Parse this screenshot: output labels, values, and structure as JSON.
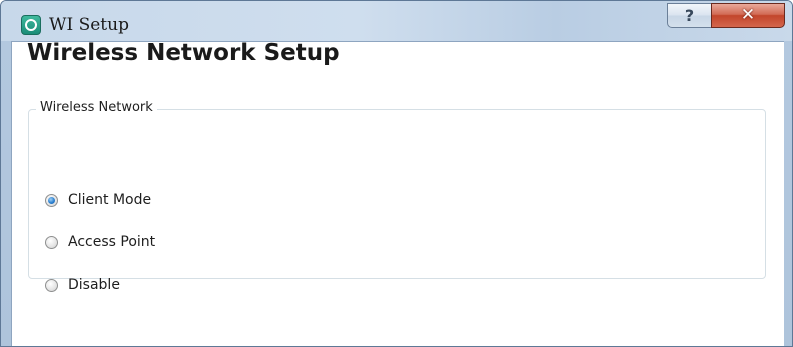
{
  "window": {
    "title": "WI Setup",
    "app_icon": "wi-app-icon",
    "help_glyph": "?",
    "close_glyph": "✕"
  },
  "page": {
    "heading": "Wireless Network Setup"
  },
  "wireless_group": {
    "legend": "Wireless Network",
    "options": [
      {
        "label": "Client Mode",
        "checked": true
      },
      {
        "label": "Access Point",
        "checked": false
      },
      {
        "label": "Disable",
        "checked": false
      }
    ]
  },
  "colors": {
    "close_button": "#c2452b",
    "radio_selected": "#2b7fcf",
    "title_bar": "#c7d8ea"
  }
}
